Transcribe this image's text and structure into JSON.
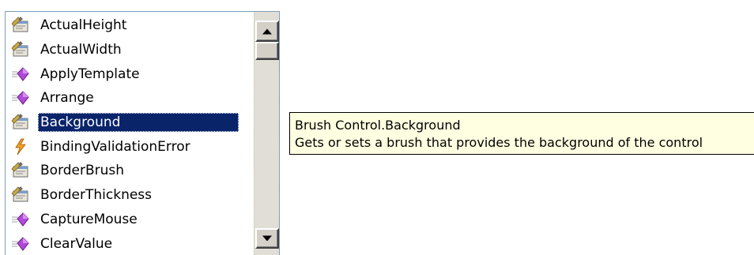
{
  "completion_list": {
    "items": [
      {
        "label": "ActualHeight",
        "icon": "property-icon",
        "selected": false
      },
      {
        "label": "ActualWidth",
        "icon": "property-icon",
        "selected": false
      },
      {
        "label": "ApplyTemplate",
        "icon": "method-icon",
        "selected": false
      },
      {
        "label": "Arrange",
        "icon": "method-icon",
        "selected": false
      },
      {
        "label": "Background",
        "icon": "property-icon",
        "selected": true
      },
      {
        "label": "BindingValidationError",
        "icon": "event-icon",
        "selected": false
      },
      {
        "label": "BorderBrush",
        "icon": "property-icon",
        "selected": false
      },
      {
        "label": "BorderThickness",
        "icon": "property-icon",
        "selected": false
      },
      {
        "label": "CaptureMouse",
        "icon": "method-icon",
        "selected": false
      },
      {
        "label": "ClearValue",
        "icon": "method-icon",
        "selected": false
      }
    ],
    "scroll_position": 0
  },
  "tooltip": {
    "signature": "Brush Control.Background",
    "description": "Gets or sets a brush that provides the background of the control"
  },
  "colors": {
    "selection": "#0a246a",
    "tooltip_bg": "#ffffe1",
    "method_icon": "#b04ad8",
    "event_icon": "#f0a020"
  }
}
